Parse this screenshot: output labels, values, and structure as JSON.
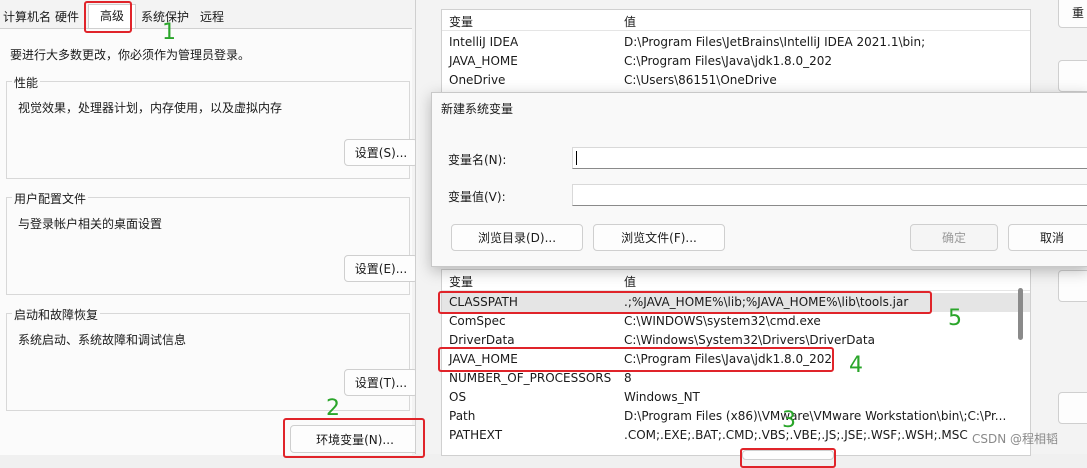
{
  "system_properties": {
    "tabs": [
      "计算机名",
      "硬件",
      "高级",
      "系统保护",
      "远程"
    ],
    "admin_notice": "要进行大多数更改，你必须作为管理员登录。",
    "performance": {
      "title": "性能",
      "desc": "视觉效果，处理器计划，内存使用，以及虚拟内存",
      "button": "设置(S)..."
    },
    "user_profiles": {
      "title": "用户配置文件",
      "desc": "与登录帐户相关的桌面设置",
      "button": "设置(E)..."
    },
    "startup_recovery": {
      "title": "启动和故障恢复",
      "desc": "系统启动、系统故障和调试信息",
      "button": "设置(T)..."
    },
    "env_button": "环境变量(N)..."
  },
  "user_vars": {
    "headers": {
      "name": "变量",
      "value": "值"
    },
    "rows": [
      {
        "name": "IntelliJ IDEA",
        "value": "D:\\Program Files\\JetBrains\\IntelliJ IDEA 2021.1\\bin;"
      },
      {
        "name": "JAVA_HOME",
        "value": "C:\\Program Files\\Java\\jdk1.8.0_202"
      },
      {
        "name": "OneDrive",
        "value": "C:\\Users\\86151\\OneDrive"
      }
    ]
  },
  "new_var_dialog": {
    "title": "新建系统变量",
    "name_label": "变量名(N):",
    "value_label": "变量值(V):",
    "name_value": "",
    "value_value": "",
    "browse_dir": "浏览目录(D)...",
    "browse_file": "浏览文件(F)...",
    "ok": "确定",
    "cancel": "取消"
  },
  "system_vars": {
    "headers": {
      "name": "变量",
      "value": "值"
    },
    "rows": [
      {
        "name": "CLASSPATH",
        "value": ".;%JAVA_HOME%\\lib;%JAVA_HOME%\\lib\\tools.jar"
      },
      {
        "name": "ComSpec",
        "value": "C:\\WINDOWS\\system32\\cmd.exe"
      },
      {
        "name": "DriverData",
        "value": "C:\\Windows\\System32\\Drivers\\DriverData"
      },
      {
        "name": "JAVA_HOME",
        "value": "C:\\Program Files\\Java\\jdk1.8.0_202"
      },
      {
        "name": "NUMBER_OF_PROCESSORS",
        "value": "8"
      },
      {
        "name": "OS",
        "value": "Windows_NT"
      },
      {
        "name": "Path",
        "value": "D:\\Program Files (x86)\\VMware\\VMware Workstation\\bin\\;C:\\Pr..."
      },
      {
        "name": "PATHEXT",
        "value": ".COM;.EXE;.BAT;.CMD;.VBS;.VBE;.JS;.JSE;.WSF;.WSH;.MSC"
      }
    ]
  },
  "top_right_button": "重",
  "annotations": [
    "1",
    "2",
    "3",
    "4",
    "5"
  ],
  "watermark": "CSDN @程相韬",
  "colors": {
    "annotation_red": "#e0242a",
    "annotation_green": "#2aa52a"
  }
}
